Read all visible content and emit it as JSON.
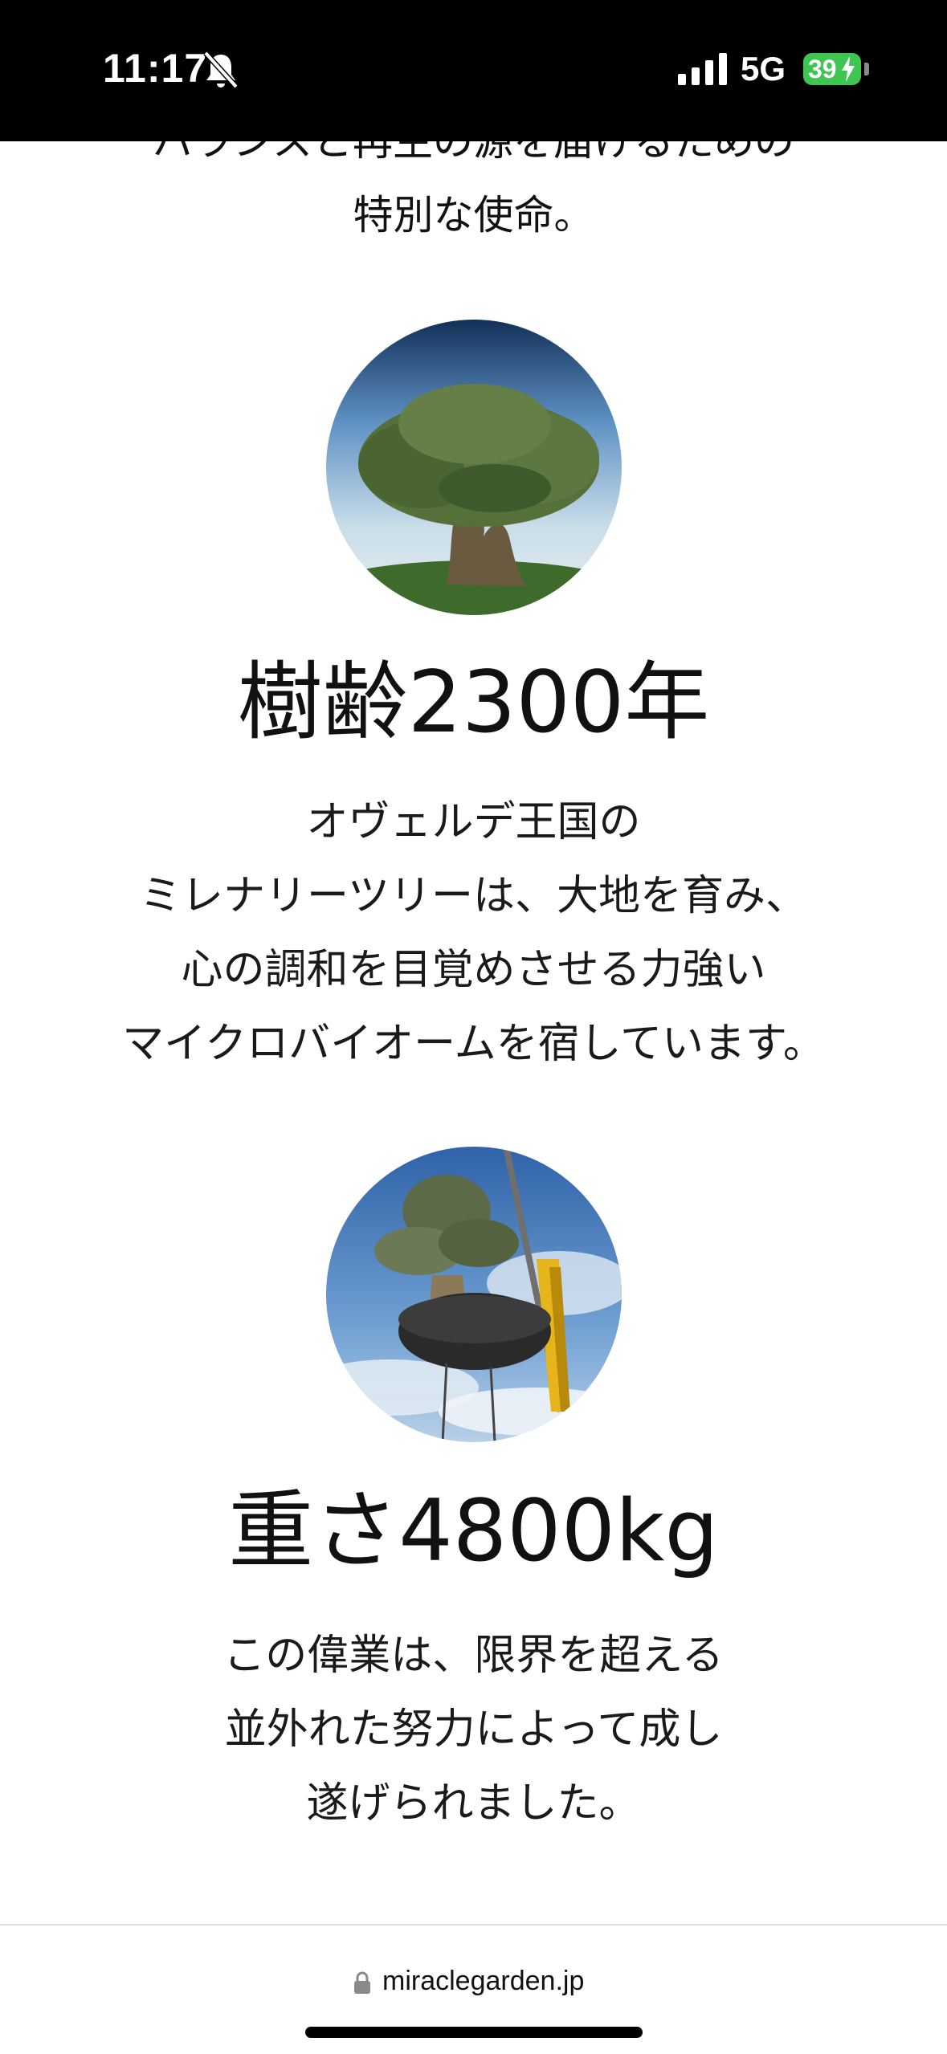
{
  "status_bar": {
    "time": "11:17",
    "network": "5G",
    "battery": "39"
  },
  "intro": {
    "lines": [
      "バランスと再生の源を届けるための",
      "特別な使命。"
    ]
  },
  "sections": [
    {
      "image_icon": "olive-tree-photo",
      "heading": "樹齢2300年",
      "lines": [
        "オヴェルデ王国の",
        "ミレナリーツリーは、大地を育み、",
        "心の調和を目覚めさせる力強い",
        "マイクロバイオームを宿しています。"
      ]
    },
    {
      "image_icon": "crane-lifting-tree-photo",
      "heading": "重さ4800kg",
      "lines": [
        "この偉業は、限界を超える",
        "並外れた努力によって成し",
        "遂げられました。"
      ]
    }
  ],
  "address_bar": {
    "url": "miraclegarden.jp"
  },
  "colors": {
    "status_bar_bg": "#000000",
    "battery_green": "#3fc552",
    "text": "#111111"
  }
}
